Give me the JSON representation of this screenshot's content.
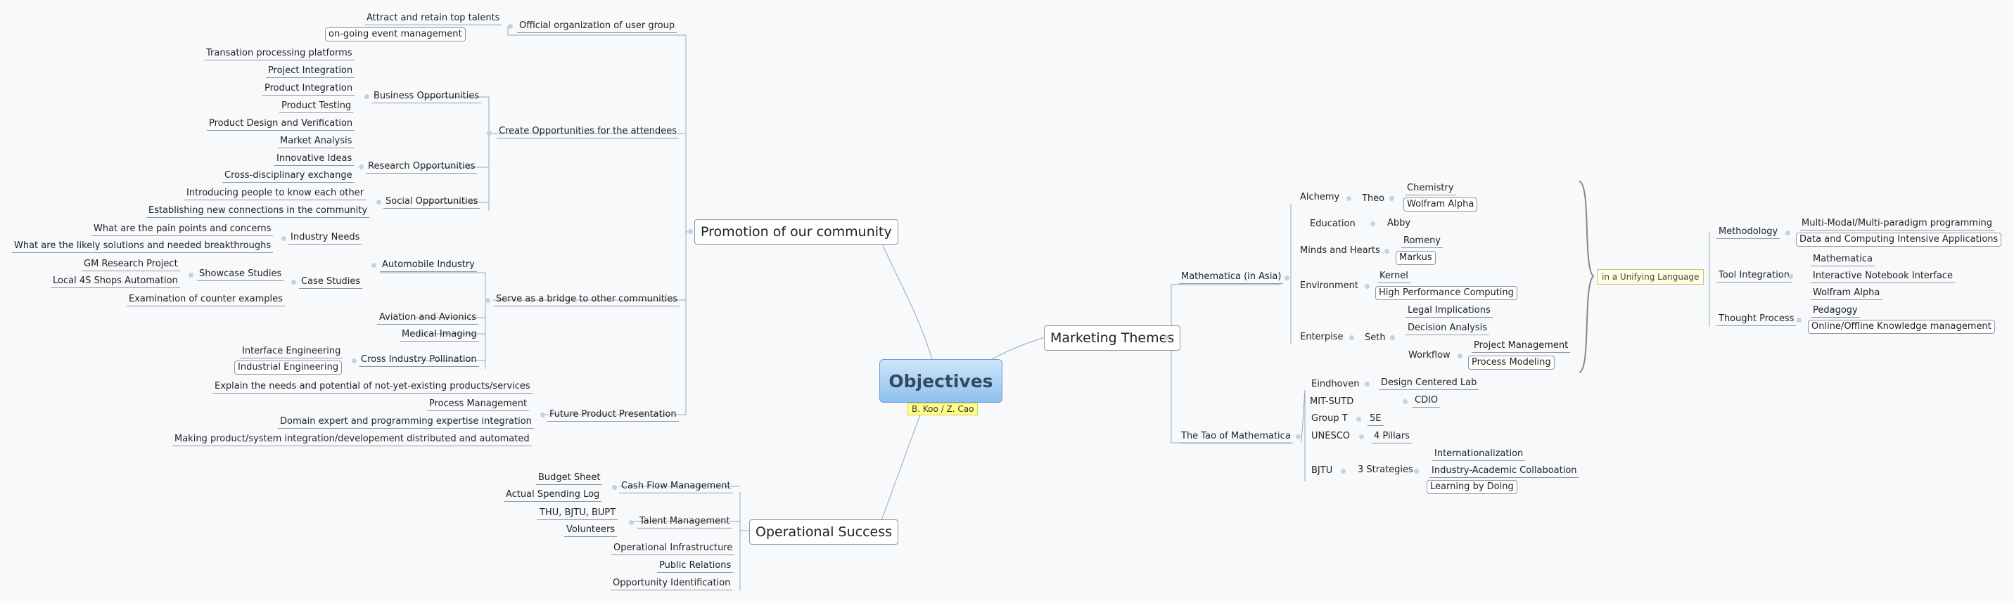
{
  "center": {
    "title": "Objectives",
    "authors": "B. Koo / Z. Cao"
  },
  "promotion": {
    "title": "Promotion of our community",
    "official_org": "Official organization of user group",
    "attract": "Attract and retain top talents",
    "event_mgmt": "on-going event management",
    "create_opps": "Create Opportunities for the attendees",
    "business_opps": "Business Opportunities",
    "business_items": [
      "Transation processing platforms",
      "Project Integration",
      "Product Integration",
      "Product Testing",
      "Product Design and Verification",
      "Market Analysis"
    ],
    "research_opps": "Research Opportunities",
    "research_items": [
      "Innovative Ideas",
      "Cross-disciplinary exchange"
    ],
    "social_opps": "Social Opportunities",
    "social_items": [
      "Introducing people to know each other",
      "Establishing new connections in the community"
    ],
    "bridge": "Serve as a bridge to other communities",
    "auto": "Automobile Industry",
    "industry_needs": "Industry Needs",
    "needs_items": [
      "What are the pain points and concerns",
      "What are the likely solutions and needed breakthroughs"
    ],
    "case_studies": "Case Studies",
    "showcase": "Showcase Studies",
    "gm": "GM Research Project",
    "local4s": "Local 4S Shops Automation",
    "counter": "Examination of counter examples",
    "aviation": "Aviation and Avionics",
    "medical": "Medical Imaging",
    "cross_poll": "Cross Industry Pollination",
    "cross_items": [
      "Interface Engineering",
      "Industrial Engineering"
    ],
    "future": "Future Product Presentation",
    "future_items": [
      "Explain the needs and potential of not-yet-existing products/services",
      "Process Management",
      "Domain expert and programming expertise integration",
      "Making product/system integration/developement distributed and automated"
    ]
  },
  "operational": {
    "title": "Operational Success",
    "cash": "Cash Flow Management",
    "cash_items": [
      "Budget Sheet",
      "Actual Spending Log"
    ],
    "talent": "Talent Management",
    "talent_items": [
      "THU, BJTU, BUPT",
      "Volunteers"
    ],
    "others": [
      "Operational Infrastructure",
      "Public Relations",
      "Opportunity Identification"
    ]
  },
  "marketing": {
    "title": "Marketing Themes",
    "asia": "Mathematica (in Asia)",
    "alchemy": "Alchemy",
    "theo": "Theo",
    "theo_items": [
      "Chemistry",
      "Wolfram Alpha"
    ],
    "education": "Education",
    "abby": "Abby",
    "minds": "Minds and Hearts",
    "minds_items": [
      "Romeny",
      "Markus"
    ],
    "environment": "Environment",
    "env_items": [
      "Kernel",
      "High Performance Computing"
    ],
    "enterprise": "Enterpise",
    "seth": "Seth",
    "seth_items": [
      "Legal Implications",
      "Decision Analysis"
    ],
    "workflow": "Workflow",
    "workflow_items": [
      "Project Management",
      "Process Modeling"
    ],
    "unifying": "in a Unifying Language",
    "methodology": "Methodology",
    "method_items": [
      "Multi-Modal/Multi-paradigm programming",
      "Data and Computing Intensive Applications"
    ],
    "tool": "Tool Integration",
    "tool_items": [
      "Mathematica",
      "Interactive Notebook Interface",
      "Wolfram Alpha"
    ],
    "thought": "Thought Process",
    "thought_items": [
      "Pedagogy",
      "Online/Offline Knowledge management"
    ],
    "tao": "The Tao of Mathematica",
    "eindhoven": "Eindhoven",
    "eindhoven_v": "Design Centered Lab",
    "mit": "MIT-SUTD",
    "mit_v": "CDIO",
    "groupt": "Group T",
    "groupt_v": "5E",
    "unesco": "UNESCO",
    "unesco_v": "4 Pillars",
    "bjtu": "BJTU",
    "strategies": "3 Strategies",
    "strategy_items": [
      "Internationalization",
      "Industry-Academic Collaboation",
      "Learning by Doing"
    ]
  }
}
